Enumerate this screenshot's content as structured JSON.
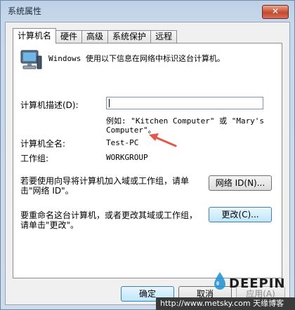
{
  "window": {
    "title": "系统属性",
    "close_glyph": "✕"
  },
  "tabs": [
    {
      "label": "计算机名",
      "active": true
    },
    {
      "label": "硬件",
      "active": false
    },
    {
      "label": "高级",
      "active": false
    },
    {
      "label": "系统保护",
      "active": false
    },
    {
      "label": "远程",
      "active": false
    }
  ],
  "panel": {
    "intro": "Windows 使用以下信息在网络中标识这台计算机。",
    "description_label": "计算机描述(D):",
    "description_value": "",
    "example_line1": "例如: \"Kitchen Computer\" 或 \"Mary's",
    "example_line2": "Computer\"。",
    "fullname_label": "计算机全名:",
    "fullname_value": "Test-PC",
    "workgroup_label": "工作组:",
    "workgroup_value": "WORKGROUP",
    "wizard_text_line1": "若要使用向导将计算机加入域或工作组，请单",
    "wizard_text_line2": "击\"网络 ID\"。",
    "network_id_button": "网络 ID(N)...",
    "rename_text_line1": "要重命名这台计算机，或者更改其域或工作组，",
    "rename_text_line2": "请单击\"更改\"。",
    "change_button": "更改(C)..."
  },
  "footer": {
    "ok_button": "确定",
    "cancel_button": "取消",
    "apply_button": "应用(A)"
  },
  "overlay": {
    "logo_text": "DEEPIN",
    "watermark_text": "http://www.metsky.com 天缘博客"
  },
  "colors": {
    "arrow": "#e4574a",
    "logo_drop": "#1d8fd1"
  }
}
